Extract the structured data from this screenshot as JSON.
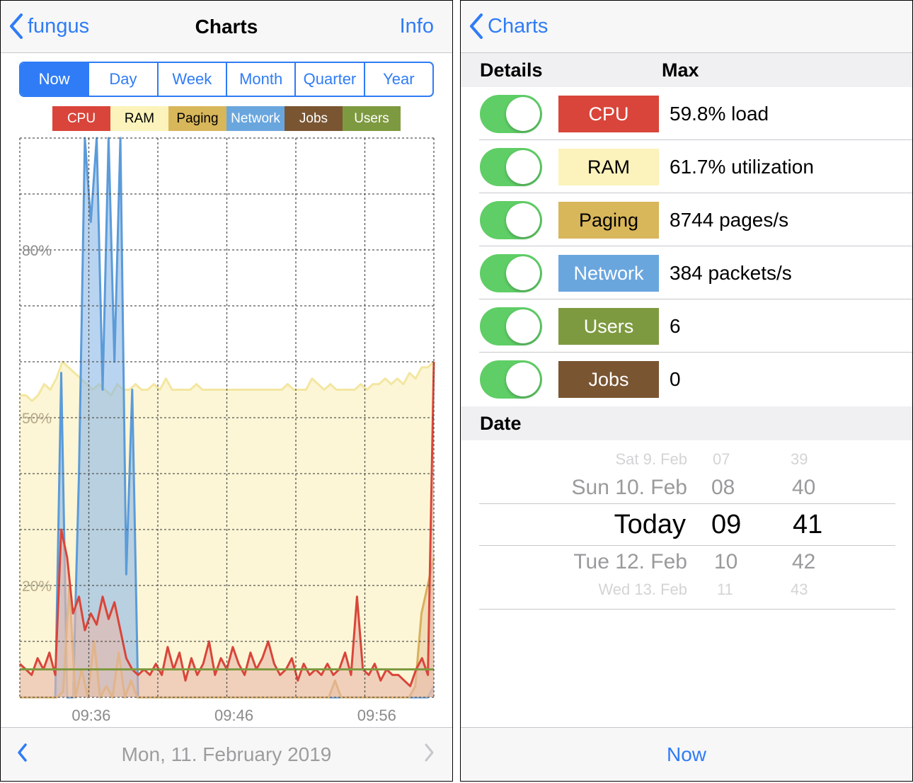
{
  "left": {
    "nav": {
      "back_label": "fungus",
      "title": "Charts",
      "right_label": "Info"
    },
    "segments": [
      {
        "label": "Now",
        "active": true
      },
      {
        "label": "Day",
        "active": false
      },
      {
        "label": "Week",
        "active": false
      },
      {
        "label": "Month",
        "active": false
      },
      {
        "label": "Quarter",
        "active": false
      },
      {
        "label": "Year",
        "active": false
      }
    ],
    "legend": [
      {
        "label": "CPU",
        "color": "#d9453a",
        "text_color": "#ffffff"
      },
      {
        "label": "RAM",
        "color": "#fbf3bb",
        "text_color": "#000000"
      },
      {
        "label": "Paging",
        "color": "#d8b65a",
        "text_color": "#000000"
      },
      {
        "label": "Network",
        "color": "#6aa6de",
        "text_color": "#ffffff"
      },
      {
        "label": "Jobs",
        "color": "#7a5532",
        "text_color": "#ffffff"
      },
      {
        "label": "Users",
        "color": "#7e9a40",
        "text_color": "#ffffff"
      }
    ],
    "date_label": "Mon, 11. February 2019"
  },
  "chart_data": {
    "type": "area",
    "x_start_time": "09:31",
    "x_end_time": "10:00",
    "x_tick_labels": [
      "09:36",
      "09:46",
      "09:56"
    ],
    "x_tick_minutes": [
      5,
      15,
      25
    ],
    "y_tick_labels": [
      "80%",
      "50%",
      "20%"
    ],
    "y_tick_values": [
      80,
      50,
      20
    ],
    "ylim": [
      0,
      100
    ],
    "grid": true,
    "series": [
      {
        "name": "RAM",
        "color": "#f3e6a0",
        "fill": "#fbf5cf",
        "values": [
          54,
          54,
          53,
          54,
          56,
          55,
          57,
          60,
          59,
          58,
          57,
          56,
          55,
          56,
          55,
          54,
          56,
          55,
          55,
          56,
          55,
          55,
          56,
          55,
          57,
          55,
          55,
          55,
          55,
          56,
          55,
          55,
          55,
          55,
          55,
          55,
          55,
          55,
          55,
          55,
          55,
          55,
          55,
          55,
          56,
          55,
          55,
          55,
          57,
          56,
          55,
          56,
          55,
          55,
          55,
          55,
          56,
          55,
          56,
          56,
          57,
          56,
          57,
          56,
          58,
          57,
          59,
          59,
          60
        ]
      },
      {
        "name": "Network",
        "color": "#5b9bd9",
        "fill": "#8ab8e6",
        "values": [
          0,
          0,
          0,
          0,
          0,
          0,
          0,
          58,
          0,
          0,
          40,
          100,
          85,
          100,
          55,
          100,
          60,
          100,
          22,
          55,
          0,
          0,
          0,
          0,
          0,
          0,
          0,
          0,
          0,
          0,
          0,
          0,
          0,
          0,
          0,
          0,
          0,
          0,
          0,
          0,
          0,
          0,
          0,
          0,
          0,
          0,
          0,
          0,
          0,
          0,
          0,
          0,
          0,
          0,
          0,
          0,
          0,
          0,
          0,
          0,
          0,
          0,
          0,
          0,
          0,
          0,
          0,
          0,
          0,
          0,
          2
        ]
      },
      {
        "name": "Paging",
        "color": "#d8b05c",
        "fill": "#e9cfa5",
        "values": [
          0,
          0,
          0,
          0,
          0,
          0,
          0,
          1,
          20,
          0,
          5,
          0,
          10,
          0,
          2,
          0,
          8,
          0,
          3,
          0,
          0,
          0,
          0,
          0,
          0,
          0,
          0,
          0,
          0,
          0,
          0,
          0,
          0,
          0,
          0,
          0,
          0,
          0,
          0,
          0,
          0,
          0,
          0,
          0,
          0,
          0,
          0,
          0,
          0,
          0,
          0,
          3,
          0,
          0,
          0,
          0,
          0,
          0,
          0,
          0,
          0,
          0,
          0,
          0,
          2,
          15,
          20,
          25
        ]
      },
      {
        "name": "CPU",
        "color": "#d9453a",
        "fill": "#e8b7a8",
        "values": [
          6,
          5,
          4,
          7,
          5,
          8,
          4,
          30,
          25,
          15,
          18,
          12,
          15,
          13,
          18,
          14,
          17,
          12,
          7,
          5,
          4,
          5,
          4,
          6,
          4,
          9,
          5,
          8,
          3,
          7,
          4,
          6,
          10,
          4,
          7,
          5,
          9,
          6,
          4,
          8,
          5,
          7,
          10,
          6,
          4,
          5,
          7,
          3,
          6,
          4,
          5,
          4,
          6,
          4,
          5,
          8,
          4,
          18,
          5,
          4,
          6,
          3,
          5,
          4,
          4,
          3,
          2,
          5,
          7,
          4,
          60
        ]
      },
      {
        "name": "Users",
        "color": "#7e9a40",
        "fill": "none",
        "values": [
          5,
          5,
          5,
          5,
          5,
          5,
          5,
          5,
          5,
          5,
          5,
          5,
          5,
          5,
          5,
          5,
          5,
          5,
          5,
          5,
          5,
          5,
          5,
          5,
          5,
          5,
          5,
          5,
          5,
          5,
          5,
          5,
          5,
          5,
          5,
          5,
          5,
          5,
          5,
          5,
          5,
          5,
          5,
          5,
          5,
          5,
          5,
          5,
          5,
          5,
          5,
          5,
          5,
          5,
          5,
          5,
          5,
          5,
          5,
          5,
          5,
          5,
          5,
          5,
          5,
          5,
          5,
          5,
          5,
          5,
          5
        ]
      }
    ]
  },
  "right": {
    "nav": {
      "back_label": "Charts"
    },
    "details_header": "Details",
    "max_header": "Max",
    "metrics": [
      {
        "label": "CPU",
        "value": "59.8% load",
        "color": "#d9453a",
        "text_color": "#ffffff"
      },
      {
        "label": "RAM",
        "value": "61.7% utilization",
        "color": "#fbf3bb",
        "text_color": "#000000"
      },
      {
        "label": "Paging",
        "value": "8744 pages/s",
        "color": "#d8b65a",
        "text_color": "#000000"
      },
      {
        "label": "Network",
        "value": "384 packets/s",
        "color": "#6aa6de",
        "text_color": "#ffffff"
      },
      {
        "label": "Users",
        "value": "6",
        "color": "#7e9a40",
        "text_color": "#ffffff"
      },
      {
        "label": "Jobs",
        "value": "0",
        "color": "#7a5532",
        "text_color": "#ffffff"
      }
    ],
    "date_header": "Date",
    "picker": {
      "days": [
        "Sat 9. Feb",
        "Sun 10. Feb",
        "Today",
        "Tue 12. Feb",
        "Wed 13. Feb"
      ],
      "hours": [
        "07",
        "08",
        "09",
        "10",
        "11"
      ],
      "minutes": [
        "39",
        "40",
        "41",
        "42",
        "43"
      ]
    },
    "now_label": "Now"
  }
}
